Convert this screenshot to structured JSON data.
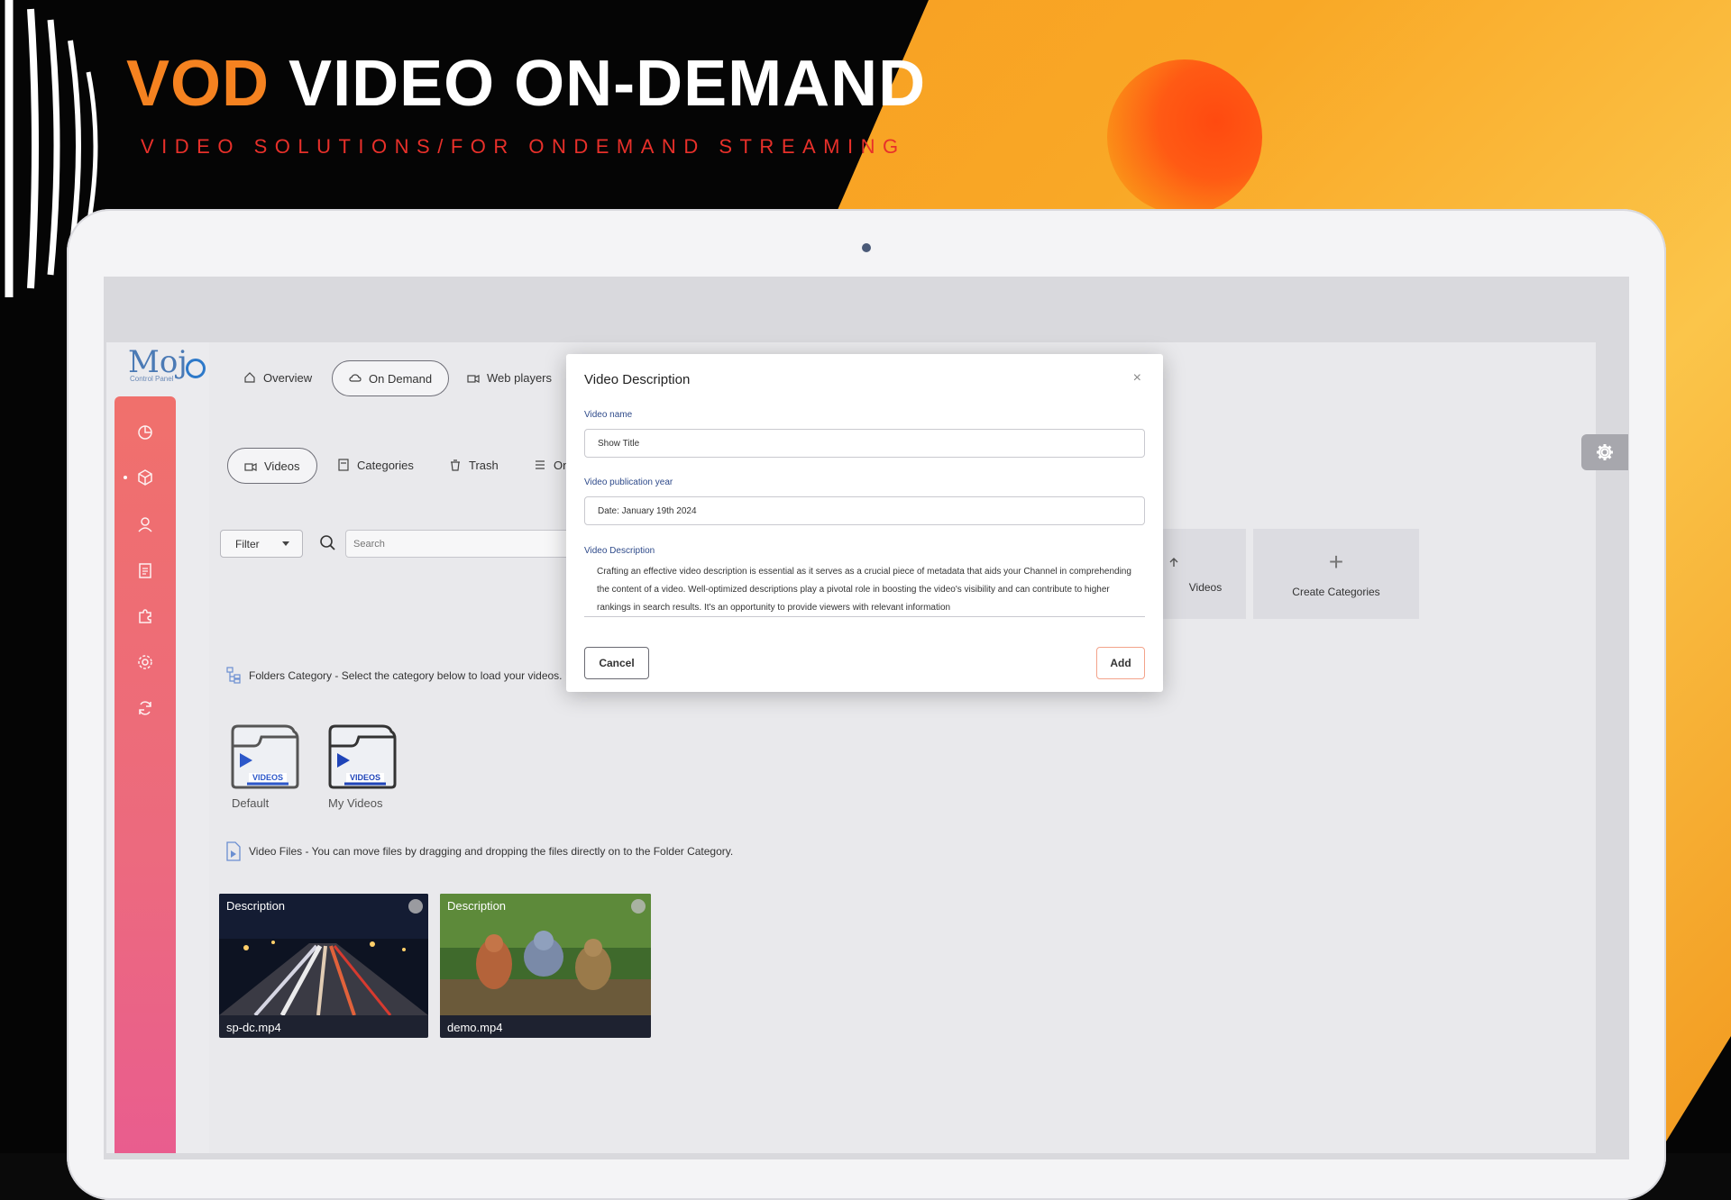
{
  "banner": {
    "headline_accent": "VOD",
    "headline_rest": "VIDEO ON-DEMAND",
    "subline": "VIDEO SOLUTIONS/FOR ONDEMAND STREAMING"
  },
  "app": {
    "logo": "Moj",
    "logo_sub": "Control Panel",
    "nav_tabs": [
      {
        "label": "Overview",
        "icon": "home-icon"
      },
      {
        "label": "On Demand",
        "icon": "cloud-icon",
        "active": true
      },
      {
        "label": "Web players",
        "icon": "player-icon"
      }
    ],
    "sub_tabs": [
      {
        "label": "Videos",
        "icon": "video-icon",
        "active": true
      },
      {
        "label": "Categories",
        "icon": "category-icon"
      },
      {
        "label": "Trash",
        "icon": "trash-icon"
      },
      {
        "label": "On",
        "icon": "list-icon"
      }
    ],
    "sidebar_icons": [
      "chart-icon",
      "cube-icon",
      "user-icon",
      "clipboard-icon",
      "puzzle-icon",
      "gear-icon",
      "refresh-icon"
    ],
    "filter_label": "Filter",
    "search_placeholder": "Search",
    "cards": [
      {
        "label": "Videos",
        "icon": "upload-icon"
      },
      {
        "label": "Create Categories",
        "icon": "plus-icon"
      }
    ],
    "folders_info": "Folders Category - Select the category below to load your videos.",
    "folders": [
      {
        "label": "Default",
        "badge": "VIDEOS"
      },
      {
        "label": "My Videos",
        "badge": "VIDEOS"
      }
    ],
    "files_info": "Video Files - You can move files by dragging and dropping the files directly on to the Folder Category.",
    "videos": [
      {
        "description": "Description",
        "filename": "sp-dc.mp4"
      },
      {
        "description": "Description",
        "filename": "demo.mp4"
      }
    ]
  },
  "modal": {
    "title": "Video Description",
    "close": "×",
    "name_label": "Video name",
    "name_value": "Show Title",
    "year_label": "Video publication year",
    "year_value": "Date: January 19th 2024",
    "desc_label": "Video Description",
    "desc_value": "Crafting an effective video description is essential as it serves as a crucial piece of metadata that aids your Channel in comprehending the content of a video. Well-optimized descriptions play a pivotal role in boosting the video's visibility and can contribute to higher rankings in search results. It's an opportunity to provide viewers with relevant information",
    "cancel": "Cancel",
    "add": "Add"
  },
  "colors": {
    "accent_orange": "#f58220",
    "subline_red": "#e8302a",
    "sidebar_top": "#f0706c",
    "sidebar_bottom": "#e95d8e",
    "label_blue": "#2e4a8a"
  }
}
